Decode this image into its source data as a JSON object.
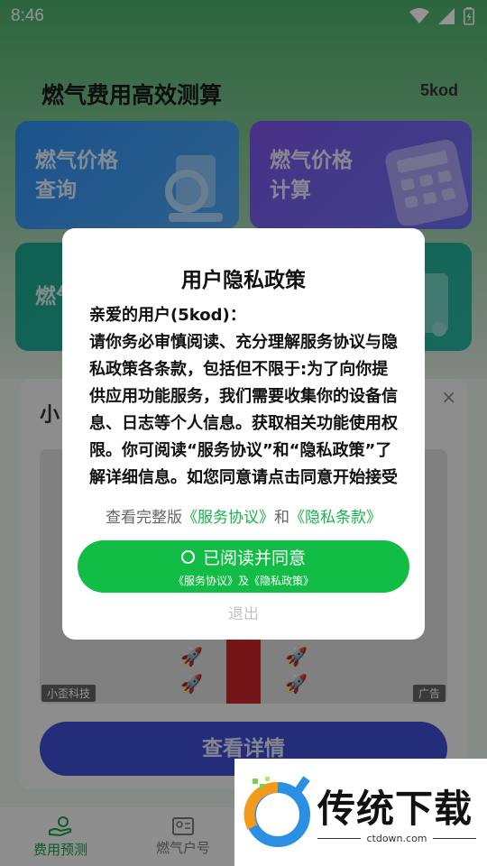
{
  "status_bar": {
    "time": "8:46"
  },
  "app": {
    "title": "燃气费用高效测算",
    "brand": "5kod"
  },
  "cards": [
    {
      "label_line1": "燃气价格",
      "label_line2": "查询"
    },
    {
      "label_line1": "燃气价格",
      "label_line2": "计算"
    },
    {
      "label_line1": "燃气",
      "label_line2": ""
    }
  ],
  "ad": {
    "title_peek": "小",
    "close": "×",
    "source": "小歪科技",
    "tag": "广告",
    "detail_button": "查看详情"
  },
  "tabs": [
    {
      "label": "费用预测",
      "icon": "hand-coin-icon"
    },
    {
      "label": "燃气户号",
      "icon": "id-card-icon"
    }
  ],
  "dialog": {
    "title": "用户隐私政策",
    "body_lines": [
      "亲爱的用户(5kod)：",
      "请你务必审慎阅读、充分理解服务协议与隐私政策各条款，包括但不限于:为了向你提供应用功能服务，我们需要收集你的设备信息、日志等个人信息。获取相关功能使用权限。你可阅读“服务协议”和“隐私政策”了解详细信息。如您同意请点击同意开始接受"
    ],
    "links_prefix": "查看完整版",
    "link_service": "《服务协议》",
    "links_and": "和",
    "link_privacy": "《隐私条款》",
    "agree_main": "已阅读并同意",
    "agree_sub": "《服务协议》及《隐私政策》",
    "exit": "退出"
  },
  "watermark": {
    "name": "传统下载",
    "url": "ctdown.com"
  },
  "colors": {
    "accent": "#12bd46",
    "link": "#17b24a",
    "detail_button": "#3d4fd0"
  }
}
